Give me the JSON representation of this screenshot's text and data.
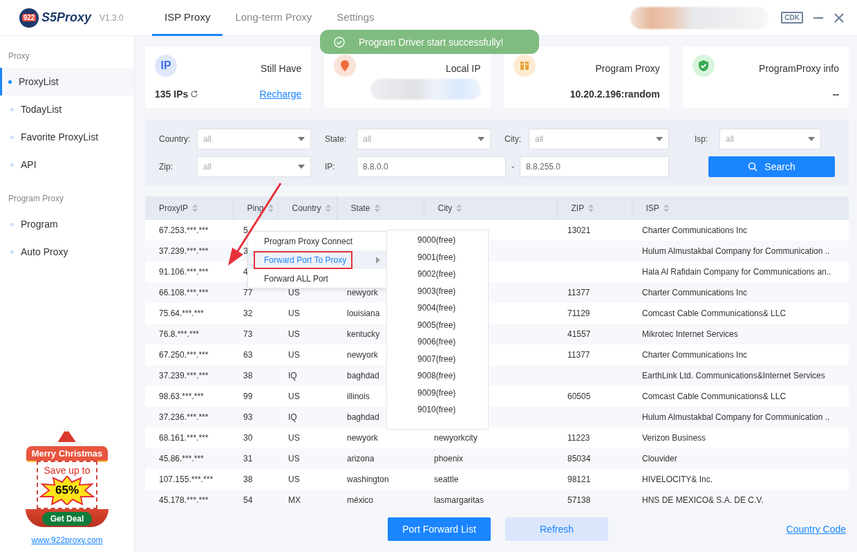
{
  "logo": {
    "badge": "922",
    "name": "S5Proxy",
    "version": "V1.3.0"
  },
  "tabs": [
    {
      "label": "ISP Proxy",
      "selected": true
    },
    {
      "label": "Long-term Proxy",
      "selected": false
    },
    {
      "label": "Settings",
      "selected": false
    }
  ],
  "cdk_label": "CDK",
  "toast": {
    "message": "Program Driver start successfully!"
  },
  "sidebar": {
    "sections": [
      {
        "title": "Proxy",
        "items": [
          {
            "label": "ProxyList",
            "selected": true
          },
          {
            "label": "TodayList",
            "selected": false
          },
          {
            "label": "Favorite ProxyList",
            "selected": false
          },
          {
            "label": "API",
            "selected": false
          }
        ]
      },
      {
        "title": "Program Proxy",
        "items": [
          {
            "label": "Program",
            "selected": false
          },
          {
            "label": "Auto Proxy",
            "selected": false
          }
        ]
      }
    ],
    "promo": {
      "ribbon": "Merry Christmas",
      "headline": "Save up to",
      "discount": "65%",
      "button": "Get Deal"
    },
    "link": "www.922proxy.com"
  },
  "cards": [
    {
      "kind": "ip",
      "badge": "IP",
      "title": "Still Have",
      "value": "135 IPs",
      "link": "Recharge"
    },
    {
      "kind": "location",
      "title": "Local IP"
    },
    {
      "kind": "program",
      "title": "Program Proxy",
      "value": "10.20.2.196:random"
    },
    {
      "kind": "shield",
      "title": "ProgramProxy info",
      "value": "--"
    }
  ],
  "filters": [
    [
      {
        "label": "Country:",
        "kind": "select",
        "placeholder": "all"
      },
      {
        "label": "State:",
        "kind": "select",
        "placeholder": "all"
      },
      {
        "label": "City:",
        "kind": "select",
        "placeholder": "all"
      },
      {
        "label": "Isp:",
        "kind": "select",
        "placeholder": "all"
      }
    ],
    [
      {
        "label": "Zip:",
        "kind": "select",
        "placeholder": "all"
      },
      {
        "label": "IP:",
        "kind": "range",
        "value": "8.8.0.0",
        "separator": "-",
        "value_to": "8.8.255.0"
      },
      {
        "kind": "button",
        "value": "Search"
      }
    ]
  ],
  "table": {
    "columns": [
      "ProxyIP",
      "Ping",
      "Country",
      "State",
      "City",
      "ZIP",
      "ISP"
    ],
    "rows": [
      [
        "67.253.***.***",
        "5",
        "",
        "",
        "",
        "13021",
        "Charter Communications Inc"
      ],
      [
        "37.239.***.***",
        "3",
        "",
        "",
        "",
        "",
        "Hulum Almustakbal Company for Communication .."
      ],
      [
        "91.106.***.***",
        "4",
        "",
        "",
        "",
        "",
        "Hala Al Rafidain Company for Communications an.."
      ],
      [
        "66.108.***.***",
        "77",
        "US",
        "newyork",
        "",
        "11377",
        "Charter Communications Inc"
      ],
      [
        "75.64.***.***",
        "32",
        "US",
        "louisiana",
        "",
        "71129",
        "Comcast Cable Communications& LLC"
      ],
      [
        "76.8.***.***",
        "73",
        "US",
        "kentucky",
        "",
        "41557",
        "Mikrotec Internet Services"
      ],
      [
        "67.250.***.***",
        "63",
        "US",
        "newyork",
        "",
        "11377",
        "Charter Communications Inc"
      ],
      [
        "37.239.***.***",
        "38",
        "IQ",
        "baghdad",
        "",
        "",
        "EarthLink Ltd. Communications&Internet Services"
      ],
      [
        "98.63.***.***",
        "99",
        "US",
        "illinois",
        "",
        "60505",
        "Comcast Cable Communications& LLC"
      ],
      [
        "37.236.***.***",
        "93",
        "IQ",
        "baghdad",
        "",
        "",
        "Hulum Almustakbal Company for Communication .."
      ],
      [
        "68.161.***.***",
        "30",
        "US",
        "newyork",
        "newyorkcity",
        "11223",
        "Verizon Business"
      ],
      [
        "45.86.***.***",
        "31",
        "US",
        "arizona",
        "phoenix",
        "85034",
        "Clouvider"
      ],
      [
        "107.155.***.***",
        "38",
        "US",
        "washington",
        "seattle",
        "98121",
        "HIVELOCITY& Inc."
      ],
      [
        "45.178.***.***",
        "54",
        "MX",
        "méxico",
        "lasmargaritas",
        "57138",
        "HNS DE MEXICO& S.A. DE C.V."
      ]
    ]
  },
  "context_menu": {
    "items": [
      {
        "label": "Program Proxy Connect",
        "selected": false,
        "submenu": false,
        "outlined": false
      },
      {
        "label": "Forward Port To Proxy",
        "selected": true,
        "submenu": true,
        "outlined": true
      },
      {
        "label": "Forward ALL Port",
        "selected": false,
        "submenu": false,
        "outlined": false
      }
    ],
    "submenu": [
      "9000(free)",
      "9001(free)",
      "9002(free)",
      "9003(free)",
      "9004(free)",
      "9005(free)",
      "9006(free)",
      "9007(free)",
      "9008(free)",
      "9009(free)",
      "9010(free)"
    ]
  },
  "footer": {
    "buttons": [
      {
        "label": "Port Forward List",
        "kind": "primary"
      },
      {
        "label": "Refresh",
        "kind": "secondary"
      }
    ],
    "link": "Country Code"
  }
}
